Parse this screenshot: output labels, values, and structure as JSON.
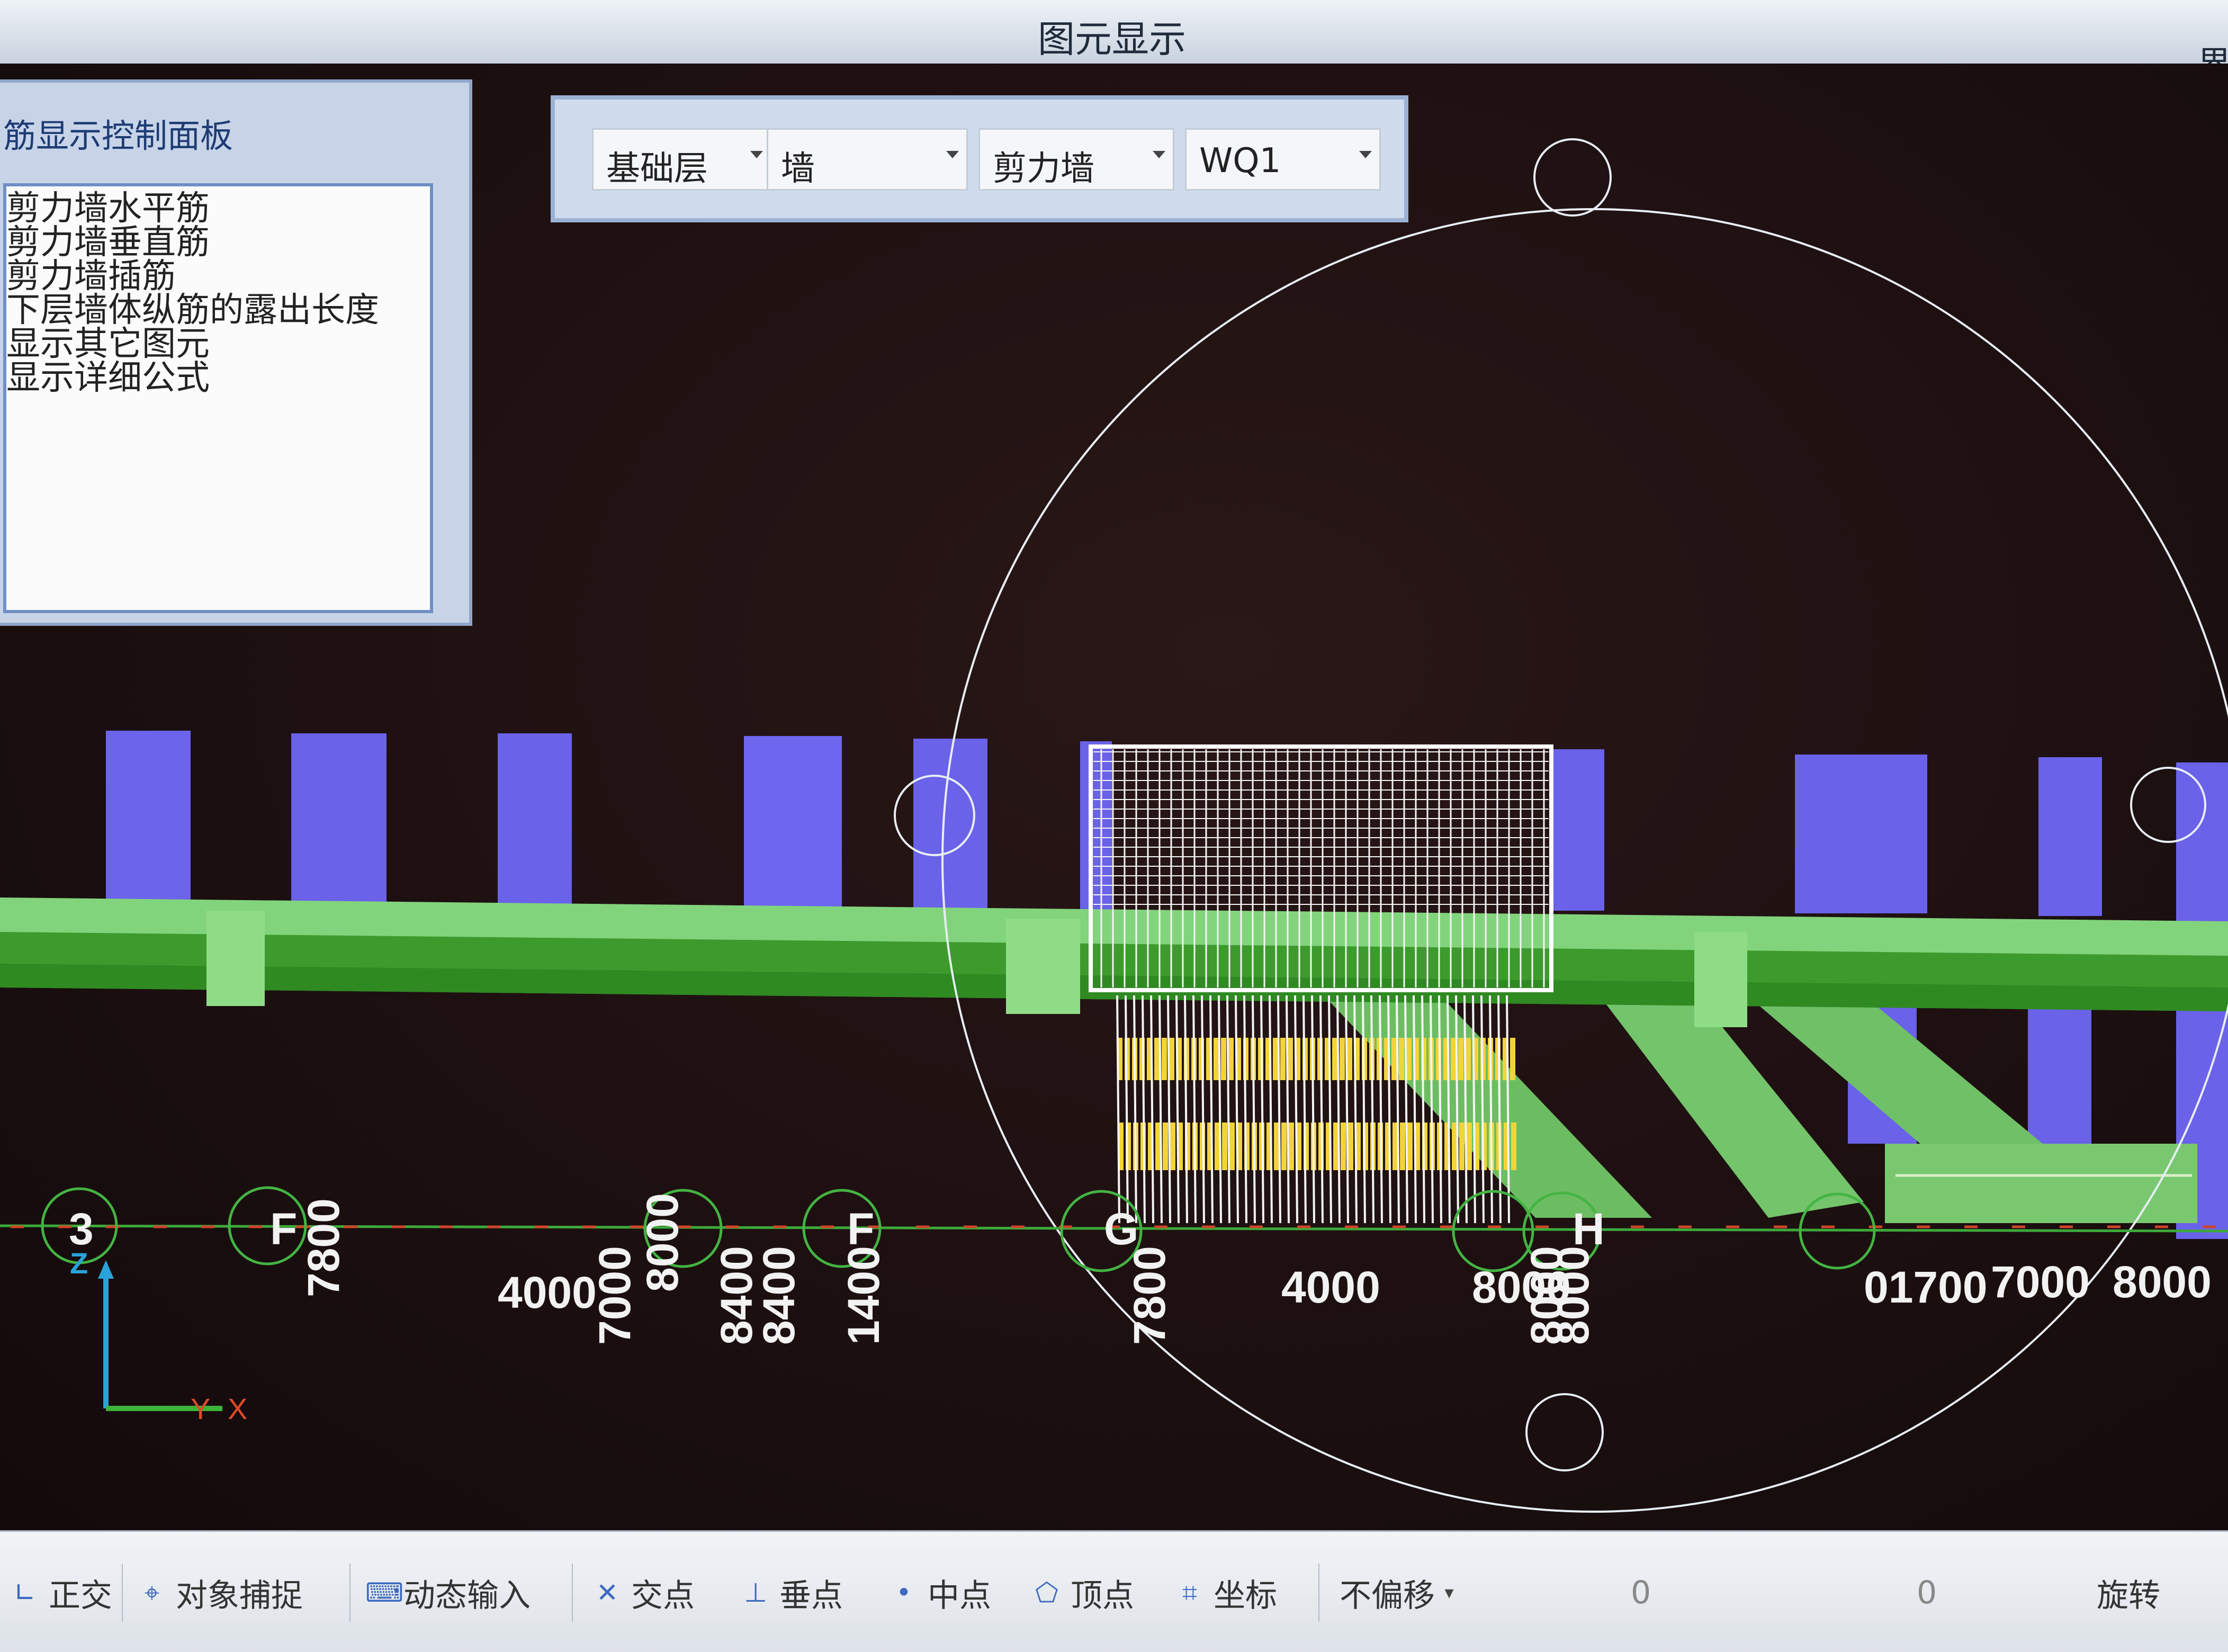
{
  "window": {
    "title": "图元显示",
    "side_text": "界"
  },
  "control_panel": {
    "title": "筋显示控制面板",
    "items": [
      "剪力墙水平筋",
      "剪力墙垂直筋",
      "剪力墙插筋",
      "下层墙体纵筋的露出长度",
      "显示其它图元",
      "显示详细公式"
    ]
  },
  "filters": {
    "floor": "基础层",
    "element_type": "墙",
    "wall_type": "剪力墙",
    "element_name": "WQ1"
  },
  "axis": {
    "labels": [
      "3",
      "F",
      "7800",
      "4000",
      "7000",
      "8000",
      "F",
      "8400",
      "8400",
      "1400",
      "G",
      "7800",
      "4000",
      "8000",
      "H",
      "8000",
      "8000",
      "01700",
      "7000",
      "8000"
    ],
    "coord_x": "X",
    "coord_y": "Y",
    "coord_z": "Z"
  },
  "statusbar": {
    "ortho": "正交",
    "object_snap": "对象捕捉",
    "dynamic_input": "动态输入",
    "intersection": "交点",
    "perpendicular": "垂点",
    "midpoint": "中点",
    "vertex": "顶点",
    "coordinate": "坐标",
    "offset_mode": "不偏移",
    "x_value": "0",
    "y_value": "0",
    "rotate": "旋转"
  },
  "colors": {
    "canvas": "#1c0f10",
    "beam_light": "#7fd07a",
    "beam_dark": "#3f9e2e",
    "column": "#6a62e8",
    "rebar_yellow": "#f2d43a",
    "rebar_white": "#f5f5f5",
    "axis_circle": "#4fb04a"
  }
}
